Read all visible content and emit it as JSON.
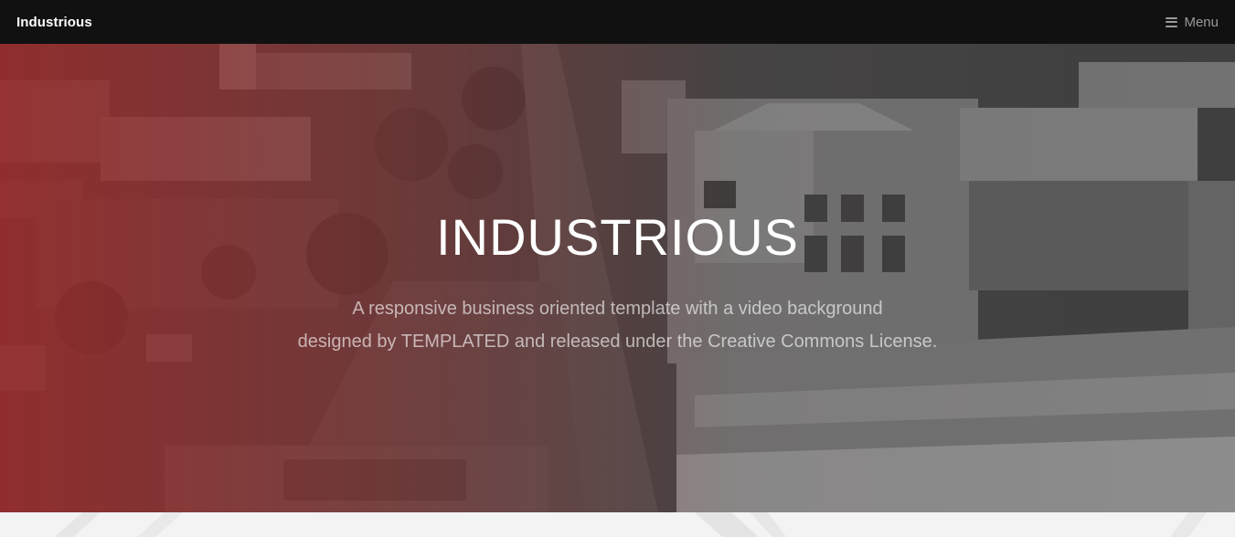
{
  "header": {
    "logo": "Industrious",
    "menu_label": "Menu",
    "menu_icon": "hamburger-icon"
  },
  "banner": {
    "title": "INDUSTRIOUS",
    "description_line1": "A responsive business oriented template with a video background",
    "description_line2": "designed by TEMPLATED and released under the Creative Commons License.",
    "tint_color": "#a02828"
  },
  "colors": {
    "header_bg": "#111111",
    "header_text": "#ffffff",
    "menu_text": "#9a9a9a",
    "page_bg": "#f3f3f3"
  }
}
